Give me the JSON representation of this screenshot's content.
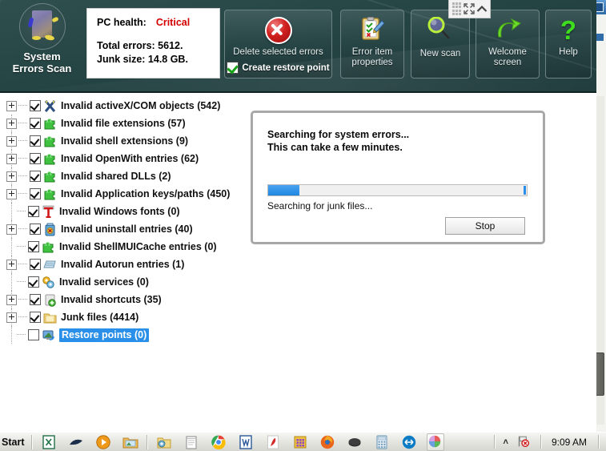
{
  "app": {
    "brand_line1": "System",
    "brand_line2": "Errors Scan",
    "logo_icon": "mascot-logo-icon"
  },
  "health": {
    "label": "PC health:",
    "status": "Critical",
    "status_color": "#d40000",
    "total_errors": "Total errors: 5612.",
    "junk_size": "Junk size: 14.8 GB."
  },
  "toolbar": {
    "delete": {
      "label": "Delete selected errors",
      "icon": "red-x-circle-icon",
      "restore_checkbox_label": "Create restore point",
      "restore_checked": true
    },
    "properties": {
      "label_line1": "Error item",
      "label_line2": "properties",
      "icon": "clipboard-pencil-icon"
    },
    "new_scan": {
      "label": "New scan",
      "icon": "magnifier-icon"
    },
    "welcome": {
      "label_line1": "Welcome",
      "label_line2": "screen",
      "icon": "undo-arrow-icon"
    },
    "help": {
      "label": "Help",
      "icon": "question-mark-icon"
    }
  },
  "overlay_widget": {
    "grip_icon": "dotted-grip-icon",
    "expand_icon": "expand-fullscreen-icon",
    "collapse_icon": "chevron-up-icon"
  },
  "tree": {
    "items": [
      {
        "label": "Invalid activeX/COM objects (542)",
        "checked": true,
        "expandable": true,
        "icon": "crossed-tools-icon",
        "selected": false
      },
      {
        "label": "Invalid file extensions (57)",
        "checked": true,
        "expandable": true,
        "icon": "green-puzzle-icon",
        "selected": false
      },
      {
        "label": "Invalid shell extensions (9)",
        "checked": true,
        "expandable": true,
        "icon": "green-puzzle-icon",
        "selected": false
      },
      {
        "label": "Invalid OpenWith entries (62)",
        "checked": true,
        "expandable": true,
        "icon": "green-puzzle-icon",
        "selected": false
      },
      {
        "label": "Invalid shared DLLs (2)",
        "checked": true,
        "expandable": true,
        "icon": "green-puzzle-icon",
        "selected": false
      },
      {
        "label": "Invalid Application keys/paths (450)",
        "checked": true,
        "expandable": true,
        "icon": "green-puzzle-icon",
        "selected": false
      },
      {
        "label": "Invalid Windows fonts (0)",
        "checked": true,
        "expandable": false,
        "icon": "red-font-t-icon",
        "selected": false
      },
      {
        "label": "Invalid uninstall entries (40)",
        "checked": true,
        "expandable": true,
        "icon": "uninstall-bin-icon",
        "selected": false
      },
      {
        "label": "Invalid ShellMUICache entries (0)",
        "checked": true,
        "expandable": false,
        "icon": "green-puzzle-icon",
        "selected": false
      },
      {
        "label": "Invalid Autorun entries (1)",
        "checked": true,
        "expandable": true,
        "icon": "autorun-disk-icon",
        "selected": false
      },
      {
        "label": "Invalid services (0)",
        "checked": true,
        "expandable": false,
        "icon": "gears-icon",
        "selected": false
      },
      {
        "label": "Invalid shortcuts (35)",
        "checked": true,
        "expandable": true,
        "icon": "shortcut-plus-icon",
        "selected": false
      },
      {
        "label": "Junk files (4414)",
        "checked": true,
        "expandable": true,
        "icon": "folder-icon",
        "selected": false
      },
      {
        "label": "Restore points (0)",
        "checked": false,
        "expandable": false,
        "icon": "restore-monitor-icon",
        "selected": true
      }
    ]
  },
  "dialog": {
    "title_line1": "Searching for system errors...",
    "title_line2": "This can take a few minutes.",
    "progress_percent": 12,
    "status": "Searching for junk files...",
    "stop_label": "Stop"
  },
  "taskbar": {
    "start_label": "Start",
    "items": [
      {
        "name": "excel-icon"
      },
      {
        "name": "shell-icon"
      },
      {
        "name": "media-player-icon"
      },
      {
        "name": "photo-viewer-icon"
      },
      {
        "name": "folder-sync-icon"
      },
      {
        "name": "notepad-icon"
      },
      {
        "name": "chrome-icon"
      },
      {
        "name": "word-icon"
      },
      {
        "name": "acrobat-icon"
      },
      {
        "name": "apps-grid-icon"
      },
      {
        "name": "firefox-icon"
      },
      {
        "name": "disk-icon"
      },
      {
        "name": "calculator-icon"
      },
      {
        "name": "teamviewer-icon"
      },
      {
        "name": "system-errors-scan-icon"
      }
    ],
    "tray": {
      "chevron": "˄",
      "action_center_icon": "flag-alert-icon",
      "clock": "9:09 AM"
    }
  }
}
